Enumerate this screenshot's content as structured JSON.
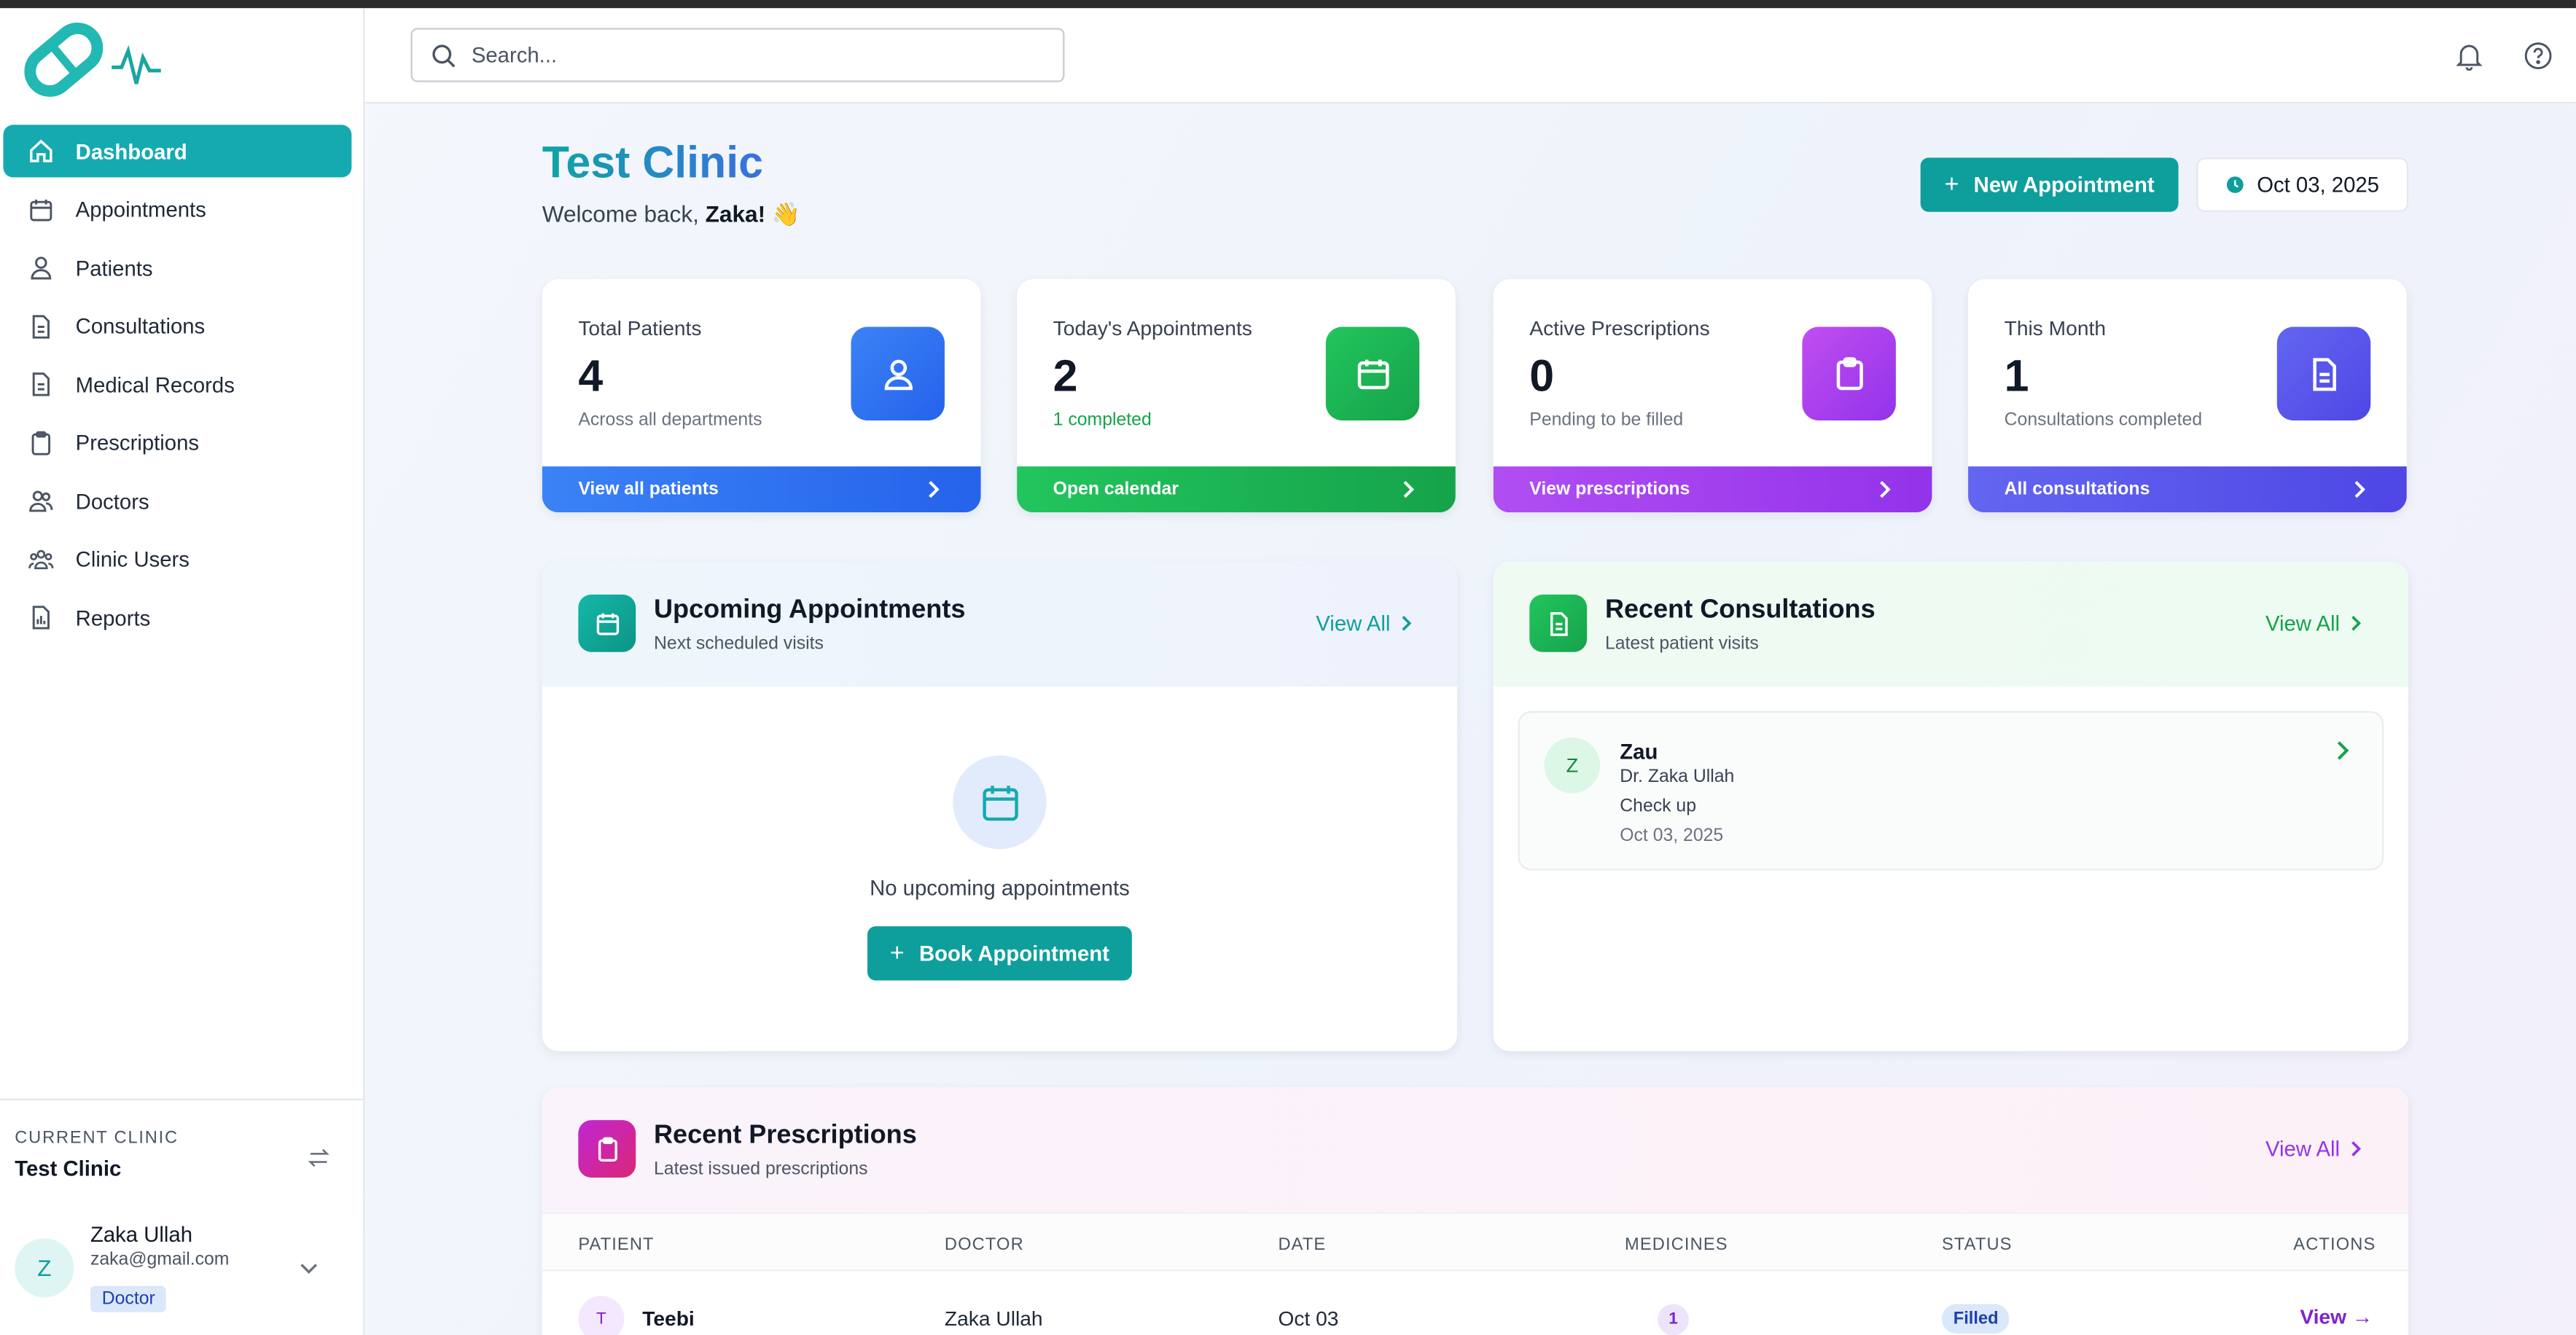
{
  "sidebar": {
    "items": [
      {
        "label": "Dashboard",
        "icon": "home-icon",
        "active": true
      },
      {
        "label": "Appointments",
        "icon": "calendar-icon"
      },
      {
        "label": "Patients",
        "icon": "user-icon"
      },
      {
        "label": "Consultations",
        "icon": "document-icon"
      },
      {
        "label": "Medical Records",
        "icon": "document-icon"
      },
      {
        "label": "Prescriptions",
        "icon": "clipboard-icon"
      },
      {
        "label": "Doctors",
        "icon": "users-icon"
      },
      {
        "label": "Clinic Users",
        "icon": "group-icon"
      },
      {
        "label": "Reports",
        "icon": "report-icon"
      }
    ],
    "current_clinic_label": "CURRENT CLINIC",
    "current_clinic_name": "Test Clinic",
    "user": {
      "initial": "Z",
      "name": "Zaka Ullah",
      "email": "zaka@gmail.com",
      "role": "Doctor"
    }
  },
  "header": {
    "search_placeholder": "Search..."
  },
  "page": {
    "title": "Test Clinic",
    "welcome_prefix": "Welcome back, ",
    "welcome_name": "Zaka!",
    "welcome_emoji": "👋",
    "new_appointment_label": "New Appointment",
    "date": "Oct 03, 2025"
  },
  "stats": [
    {
      "label": "Total Patients",
      "value": "4",
      "sub": "Across all departments",
      "link": "View all patients",
      "color": "#3b82f6"
    },
    {
      "label": "Today's Appointments",
      "value": "2",
      "sub": "1 completed",
      "link": "Open calendar",
      "color": "#22c55e"
    },
    {
      "label": "Active Prescriptions",
      "value": "0",
      "sub": "Pending to be filled",
      "link": "View prescriptions",
      "color": "#a855f7"
    },
    {
      "label": "This Month",
      "value": "1",
      "sub": "Consultations completed",
      "link": "All consultations",
      "color": "#6366f1"
    }
  ],
  "upcoming": {
    "title": "Upcoming Appointments",
    "subtitle": "Next scheduled visits",
    "view_all": "View All",
    "empty_text": "No upcoming appointments",
    "book_label": "Book Appointment"
  },
  "consultations": {
    "title": "Recent Consultations",
    "subtitle": "Latest patient visits",
    "view_all": "View All",
    "items": [
      {
        "initial": "Z",
        "name": "Zau",
        "doctor": "Dr. Zaka Ullah",
        "type": "Check up",
        "date": "Oct 03, 2025"
      }
    ]
  },
  "prescriptions": {
    "title": "Recent Prescriptions",
    "subtitle": "Latest issued prescriptions",
    "view_all": "View All",
    "columns": [
      "PATIENT",
      "DOCTOR",
      "DATE",
      "MEDICINES",
      "STATUS",
      "ACTIONS"
    ],
    "rows": [
      {
        "initial": "T",
        "patient": "Teebi",
        "doctor": "Zaka Ullah",
        "date": "Oct 03",
        "medicines": "1",
        "status": "Filled",
        "action": "View →"
      }
    ]
  }
}
